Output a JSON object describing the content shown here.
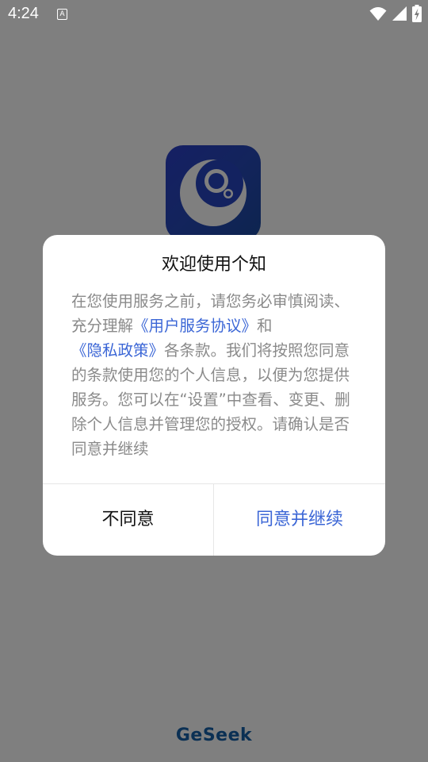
{
  "status_bar": {
    "time": "4:24",
    "notification_icon": "a-icon",
    "notification_letter": "A",
    "icons": [
      "wifi-icon",
      "signal-icon",
      "battery-charging-icon"
    ]
  },
  "splash": {
    "app_icon": "app-logo-icon",
    "brand_name": "GeSeek",
    "colors": {
      "icon_gradient_start": "#2b3fc8",
      "icon_gradient_end": "#1b4a9e",
      "brand": "#1660a8"
    }
  },
  "dialog": {
    "title": "欢迎使用个知",
    "body": {
      "text_before": "在您使用服务之前，请您务必审慎阅读、充分理解",
      "link_user_agreement": "《用户服务协议》",
      "text_and": "和",
      "link_privacy_policy": "《隐私政策》",
      "text_after": "各条款。我们将按照您同意的条款使用您的个人信息，以便为您提供服务。您可以在“设置”中查看、变更、删除个人信息并管理您的授权。请确认是否同意并继续"
    },
    "disagree_label": "不同意",
    "agree_label": "同意并继续",
    "colors": {
      "link": "#3b66d6",
      "body_text": "#8a8a8a",
      "title_text": "#111111"
    }
  }
}
